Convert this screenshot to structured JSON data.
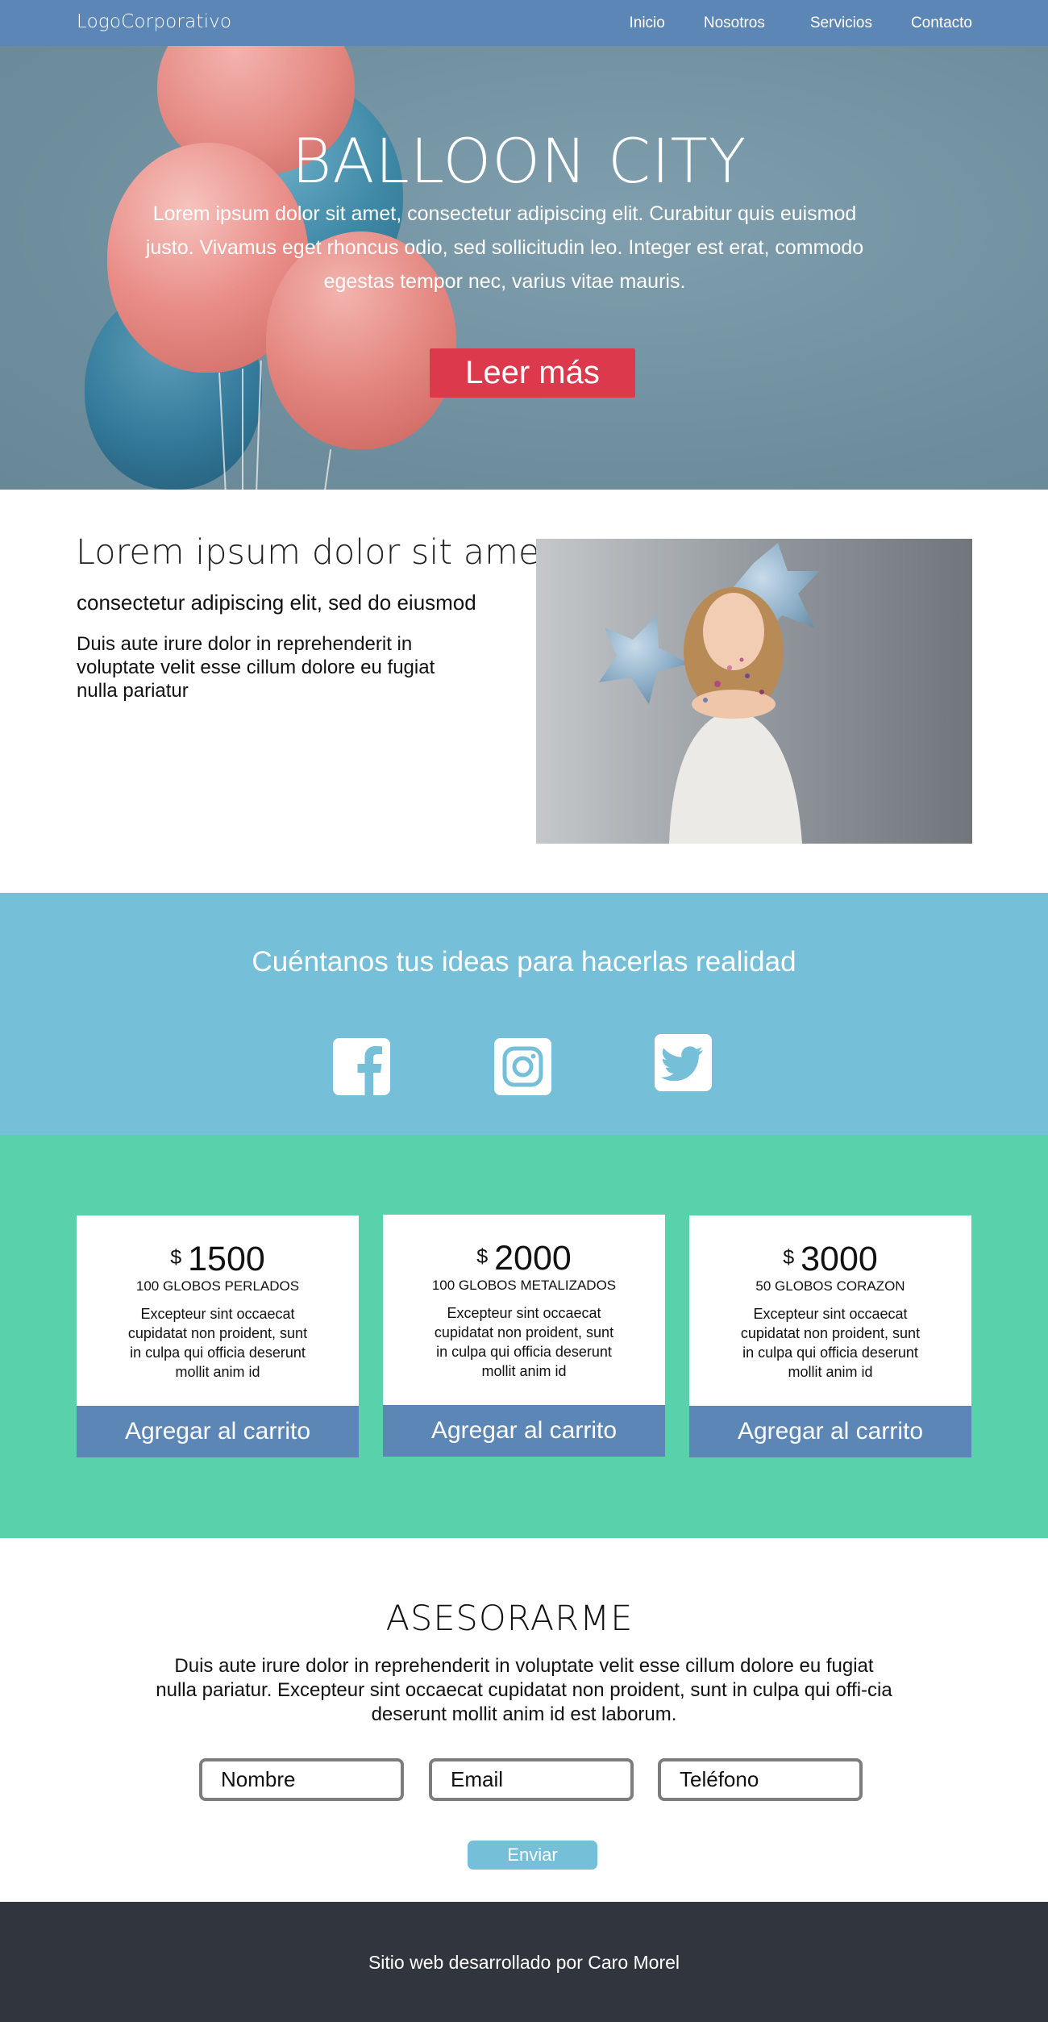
{
  "nav": {
    "logo": "LogoCorporativo",
    "links": [
      "Inicio",
      "Nosotros",
      "Servicios",
      "Contacto"
    ]
  },
  "hero": {
    "title": "BALLOON CITY",
    "text": "Lorem ipsum dolor sit amet, consectetur adipiscing elit. Curabitur quis euismod justo. Vivamus eget rhoncus odio, sed sollicitudin leo. Integer est erat, commodo egestas tempor nec, varius vitae mauris.",
    "button": "Leer más"
  },
  "about": {
    "title": "Lorem ipsum dolor sit amet",
    "subtitle": "consectetur adipiscing elit, sed do eiusmod",
    "text": "Duis aute irure dolor in reprehenderit in voluptate velit esse cillum dolore eu fugiat nulla pariatur"
  },
  "social": {
    "title": "Cuéntanos tus ideas para hacerlas realidad",
    "icons": [
      "facebook-icon",
      "instagram-icon",
      "twitter-icon"
    ]
  },
  "pricing": {
    "currency": "$",
    "button_label": "Agregar al carrito",
    "cards": [
      {
        "price": "1500",
        "name": "100 GLOBOS PERLADOS",
        "desc": "Excepteur sint occaecat cupidatat non proident, sunt in culpa qui officia deserunt mollit anim id"
      },
      {
        "price": "2000",
        "name": "100 GLOBOS METALIZADOS",
        "desc": "Excepteur sint occaecat cupidatat non proident, sunt in culpa qui officia deserunt mollit anim id"
      },
      {
        "price": "3000",
        "name": "50 GLOBOS CORAZON",
        "desc": "Excepteur sint occaecat cupidatat non proident, sunt in culpa qui officia deserunt mollit anim id"
      }
    ]
  },
  "asesorarme": {
    "title": "ASESORARME",
    "text": "Duis aute irure dolor in reprehenderit in voluptate velit esse cillum dolore eu fugiat nulla pariatur. Excepteur sint occaecat cupidatat non proident, sunt in culpa qui offi-cia deserunt mollit anim id est laborum.",
    "placeholders": {
      "name": "Nombre",
      "email": "Email",
      "phone": "Teléfono"
    },
    "send": "Enviar"
  },
  "footer": {
    "text": "Sitio web desarrollado por Caro Morel"
  },
  "colors": {
    "nav": "#5b86b6",
    "cta": "#dc3a4c",
    "social_band": "#76bfd9",
    "pricing_band": "#59d2ac",
    "footer": "#31353e"
  }
}
